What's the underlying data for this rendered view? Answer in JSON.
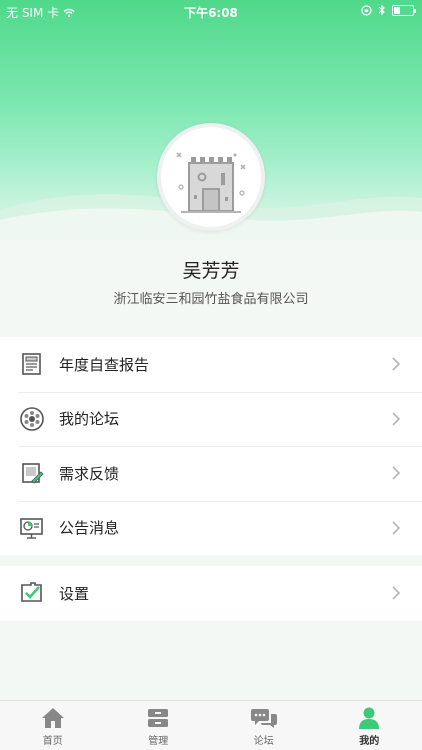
{
  "status_bar": {
    "carrier": "无 SIM 卡",
    "time": "下午6:08",
    "battery_level": 0.35
  },
  "profile": {
    "name": "吴芳芳",
    "company": "浙江临安三和园竹盐食品有限公司",
    "avatar_icon": "castle-icon"
  },
  "menu": {
    "items": [
      {
        "label": "年度自查报告",
        "icon": "report-icon"
      },
      {
        "label": "我的论坛",
        "icon": "forum-icon"
      },
      {
        "label": "需求反馈",
        "icon": "feedback-icon"
      },
      {
        "label": "公告消息",
        "icon": "announcement-icon"
      }
    ],
    "settings": {
      "label": "设置",
      "icon": "settings-icon"
    }
  },
  "tabbar": {
    "tabs": [
      {
        "label": "首页",
        "icon": "home-icon"
      },
      {
        "label": "管理",
        "icon": "manage-icon"
      },
      {
        "label": "论坛",
        "icon": "chat-icon"
      },
      {
        "label": "我的",
        "icon": "person-icon"
      }
    ],
    "active_index": 3
  },
  "colors": {
    "accent": "#3cc97a",
    "icon_gray": "#666666"
  }
}
